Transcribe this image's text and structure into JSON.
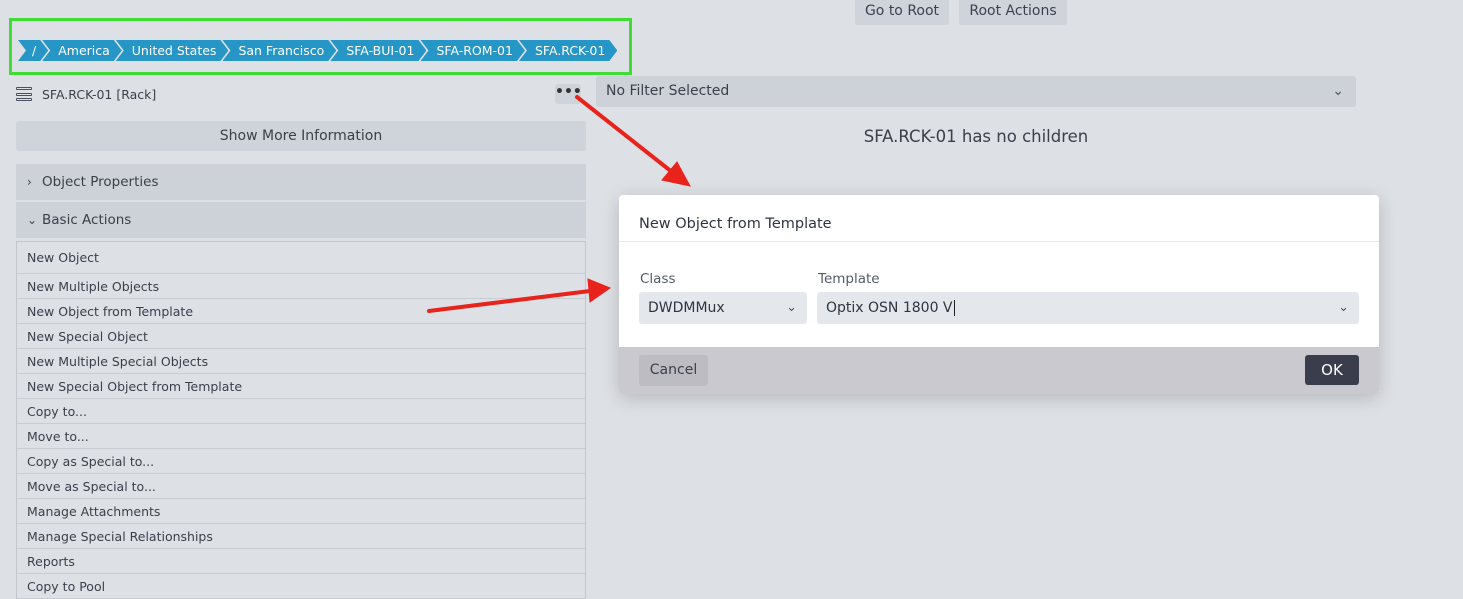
{
  "header": {
    "go_to_root": "Go to Root",
    "root_actions": "Root Actions"
  },
  "breadcrumb": [
    "/",
    "America",
    "United States",
    "San Francisco",
    "SFA-BUI-01",
    "SFA-ROM-01",
    "SFA.RCK-01"
  ],
  "object": {
    "label": "SFA.RCK-01 [Rack]",
    "menu_glyph": "•••"
  },
  "filter": {
    "value": "No Filter Selected"
  },
  "no_children_text": "SFA.RCK-01 has no children",
  "show_more": "Show More Information",
  "sections": {
    "properties": "Object Properties",
    "basic_actions": "Basic Actions"
  },
  "actions": [
    "New Object",
    "New Multiple Objects",
    "New Object from Template",
    "New Special Object",
    "New Multiple Special Objects",
    "New Special Object from Template",
    "Copy to...",
    "Move to...",
    "Copy as Special to...",
    "Move as Special to...",
    "Manage Attachments",
    "Manage Special Relationships",
    "Reports",
    "Copy to Pool"
  ],
  "modal": {
    "title": "New Object from Template",
    "class_label": "Class",
    "class_value": "DWDMMux",
    "template_label": "Template",
    "template_value": "Optix OSN 1800 V",
    "cancel": "Cancel",
    "ok": "OK"
  },
  "colors": {
    "highlight_frame": "#3fdc35",
    "breadcrumb": "#2596c6",
    "annotation_arrow": "#e8231b",
    "ok_button": "#3a3d4c"
  }
}
